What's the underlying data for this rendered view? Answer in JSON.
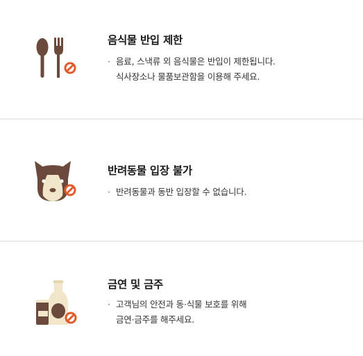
{
  "colors": {
    "brown": "#6b4a3c",
    "cream": "#f1e6c9",
    "prohibit": "#e2592b",
    "divider": "#dddddd"
  },
  "sections": [
    {
      "icon": "food-prohibited-icon",
      "title": "음식물 반입 제한",
      "lines": [
        "음료, 스낵류 외 음식물은 반입이 제한됩니다.",
        "식사장소나 물품보관함을 이용해 주세요."
      ]
    },
    {
      "icon": "pet-prohibited-icon",
      "title": "반려동물 입장 불가",
      "lines": [
        "반려동물과 동반 입장할 수 없습니다."
      ]
    },
    {
      "icon": "smoking-alcohol-prohibited-icon",
      "title": "금연 및 금주",
      "lines": [
        "고객님의 안전과 동·식물 보호를 위해",
        "금연·금주를 해주세요."
      ]
    }
  ],
  "bullet": "·"
}
